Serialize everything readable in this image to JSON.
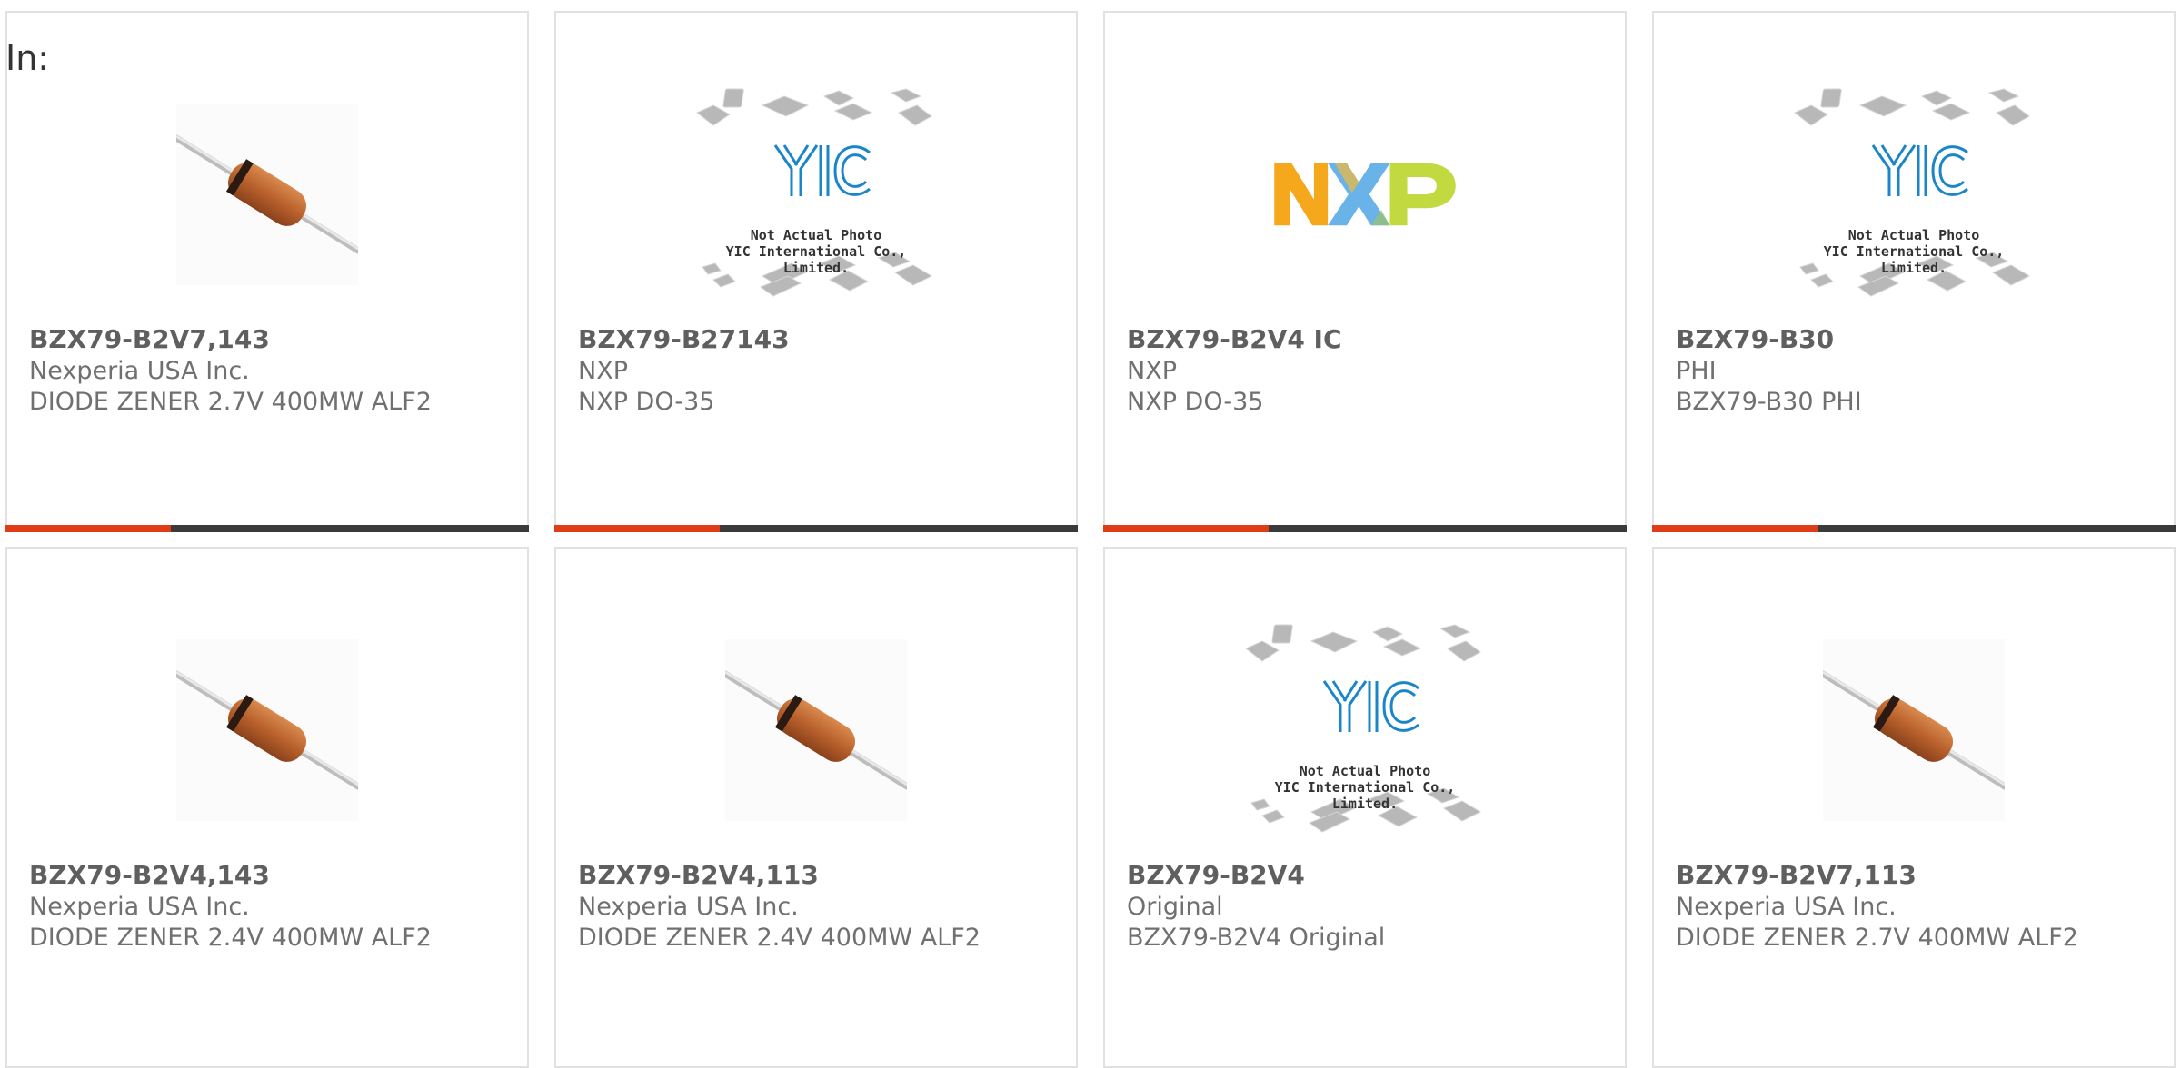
{
  "header": {
    "in_label": "In:"
  },
  "accent_color": "#e03c17",
  "cards": [
    {
      "part": "BZX79-B2V7,143",
      "manufacturer": "Nexperia USA Inc.",
      "description": "DIODE ZENER 2.7V 400MW ALF2",
      "image": "diode-icon"
    },
    {
      "part": "BZX79-B27143",
      "manufacturer": "NXP",
      "description": "NXP DO-35",
      "image": "not-actual-photo-icon",
      "image_text_1": "Not Actual Photo",
      "image_text_2": "YIC International Co., Limited."
    },
    {
      "part": "BZX79-B2V4 IC",
      "manufacturer": "NXP",
      "description": "NXP DO-35",
      "image": "nxp-logo-icon"
    },
    {
      "part": "BZX79-B30",
      "manufacturer": "PHI",
      "description": "BZX79-B30 PHI",
      "image": "not-actual-photo-icon",
      "image_text_1": "Not Actual Photo",
      "image_text_2": "YIC International Co., Limited."
    },
    {
      "part": "BZX79-B2V4,143",
      "manufacturer": "Nexperia USA Inc.",
      "description": "DIODE ZENER 2.4V 400MW ALF2",
      "image": "diode-icon"
    },
    {
      "part": "BZX79-B2V4,113",
      "manufacturer": "Nexperia USA Inc.",
      "description": "DIODE ZENER 2.4V 400MW ALF2",
      "image": "diode-icon"
    },
    {
      "part": "BZX79-B2V4",
      "manufacturer": "Original",
      "description": "BZX79-B2V4 Original",
      "image": "not-actual-photo-icon",
      "image_text_1": "Not Actual Photo",
      "image_text_2": "YIC International Co., Limited."
    },
    {
      "part": "BZX79-B2V7,113",
      "manufacturer": "Nexperia USA Inc.",
      "description": "DIODE ZENER 2.7V 400MW ALF2",
      "image": "diode-icon"
    }
  ]
}
